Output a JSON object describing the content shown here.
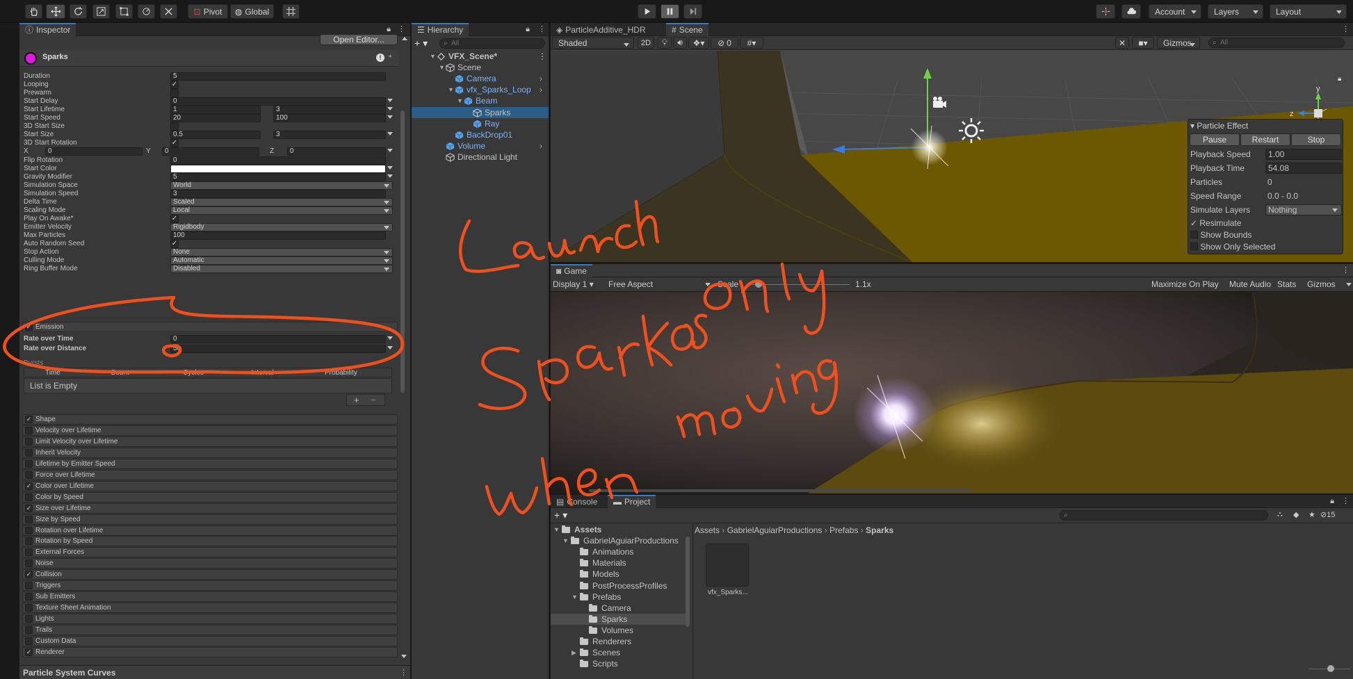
{
  "toolbar": {
    "pivot": "Pivot",
    "global": "Global",
    "account": "Account",
    "layers": "Layers",
    "layout": "Layout"
  },
  "inspector": {
    "tab": "Inspector",
    "open_editor": "Open Editor...",
    "object_name": "Sparks",
    "props": [
      {
        "label": "Duration",
        "value": "5"
      },
      {
        "label": "Looping",
        "check": true
      },
      {
        "label": "Prewarm",
        "check": false
      },
      {
        "label": "Start Delay",
        "value": "0"
      },
      {
        "label": "Start Lifetime",
        "value": "1",
        "value2": "3"
      },
      {
        "label": "Start Speed",
        "value": "20",
        "value2": "100"
      },
      {
        "label": "3D Start Size",
        "check": false
      },
      {
        "label": "Start Size",
        "value": "0.5",
        "value2": "3"
      },
      {
        "label": "3D Start Rotation",
        "check": true
      }
    ],
    "rot_xyz": {
      "x_label": "X",
      "x": "0",
      "y_label": "Y",
      "y": "0",
      "z_label": "Z",
      "z": "0"
    },
    "props2": [
      {
        "label": "Flip Rotation",
        "value": "0"
      },
      {
        "label": "Start Color",
        "color": "#ffffff"
      },
      {
        "label": "Gravity Modifier",
        "value": "5"
      },
      {
        "label": "Simulation Space",
        "popup": "World"
      },
      {
        "label": "Simulation Speed",
        "value": "3"
      },
      {
        "label": "Delta Time",
        "popup": "Scaled"
      },
      {
        "label": "Scaling Mode",
        "popup": "Local"
      },
      {
        "label": "Play On Awake*",
        "check": true
      },
      {
        "label": "Emitter Velocity",
        "popup": "Rigidbody"
      },
      {
        "label": "Max Particles",
        "value": "100"
      },
      {
        "label": "Auto Random Seed",
        "check": true
      },
      {
        "label": "Stop Action",
        "popup": "None"
      },
      {
        "label": "Culling Mode",
        "popup": "Automatic"
      },
      {
        "label": "Ring Buffer Mode",
        "popup": "Disabled"
      }
    ],
    "emission": {
      "title": "Emission",
      "rate_time_label": "Rate over Time",
      "rate_time": "0",
      "rate_dist_label": "Rate over Distance",
      "rate_dist": "50",
      "bursts_label": "Bursts",
      "cols": [
        "Time",
        "Count",
        "Cycles",
        "Interval",
        "Probability"
      ],
      "empty": "List is Empty",
      "add": "+",
      "remove": "−"
    },
    "modules": [
      {
        "label": "Shape",
        "on": true
      },
      {
        "label": "Velocity over Lifetime",
        "on": false
      },
      {
        "label": "Limit Velocity over Lifetime",
        "on": false
      },
      {
        "label": "Inherit Velocity",
        "on": false
      },
      {
        "label": "Lifetime by Emitter Speed",
        "on": false
      },
      {
        "label": "Force over Lifetime",
        "on": false
      },
      {
        "label": "Color over Lifetime",
        "on": true
      },
      {
        "label": "Color by Speed",
        "on": false
      },
      {
        "label": "Size over Lifetime",
        "on": true
      },
      {
        "label": "Size by Speed",
        "on": false
      },
      {
        "label": "Rotation over Lifetime",
        "on": false
      },
      {
        "label": "Rotation by Speed",
        "on": false
      },
      {
        "label": "External Forces",
        "on": false
      },
      {
        "label": "Noise",
        "on": false
      },
      {
        "label": "Collision",
        "on": true
      },
      {
        "label": "Triggers",
        "on": false
      },
      {
        "label": "Sub Emitters",
        "on": false
      },
      {
        "label": "Texture Sheet Animation",
        "on": false
      },
      {
        "label": "Lights",
        "on": false
      },
      {
        "label": "Trails",
        "on": false
      },
      {
        "label": "Custom Data",
        "on": false
      },
      {
        "label": "Renderer",
        "on": true
      }
    ],
    "curves": "Particle System Curves"
  },
  "hierarchy": {
    "tab": "Hierarchy",
    "search": "All",
    "items": [
      {
        "label": "VFX_Scene*",
        "depth": 0,
        "type": "scene",
        "arrow": "▼",
        "bold": true
      },
      {
        "label": "Scene",
        "depth": 1,
        "type": "go",
        "arrow": "▼"
      },
      {
        "label": "Camera",
        "depth": 2,
        "type": "prefab",
        "arrow": "",
        "more": true
      },
      {
        "label": "vfx_Sparks_Loop",
        "depth": 2,
        "type": "prefab",
        "arrow": "▼",
        "more": true
      },
      {
        "label": "Beam",
        "depth": 3,
        "type": "prefab",
        "arrow": "▼"
      },
      {
        "label": "Sparks",
        "depth": 4,
        "type": "go",
        "arrow": "",
        "sel": true
      },
      {
        "label": "Ray",
        "depth": 4,
        "type": "prefab",
        "arrow": ""
      },
      {
        "label": "BackDrop01",
        "depth": 2,
        "type": "prefab",
        "arrow": ""
      },
      {
        "label": "Volume",
        "depth": 1,
        "type": "prefab",
        "arrow": "",
        "more": true
      },
      {
        "label": "Directional Light",
        "depth": 1,
        "type": "go",
        "arrow": ""
      }
    ]
  },
  "scene_tabs": {
    "tab1": "ParticleAdditive_HDR",
    "tab2": "Scene",
    "shading": "Shaded",
    "mode2d": "2D",
    "hidden_count": "0",
    "gizmos": "Gizmos",
    "search": "All"
  },
  "particle_effect": {
    "title": "Particle Effect",
    "pause": "Pause",
    "restart": "Restart",
    "stop": "Stop",
    "speed_label": "Playback Speed",
    "speed": "1.00",
    "time_label": "Playback Time",
    "time": "54.08",
    "particles_label": "Particles",
    "particles": "0",
    "range_label": "Speed Range",
    "range": "0.0 - 0.0",
    "layers_label": "Simulate Layers",
    "layers": "Nothing",
    "resim": "Resimulate",
    "bounds": "Show Bounds",
    "only_sel": "Show Only Selected"
  },
  "game": {
    "tab": "Game",
    "display": "Display 1",
    "aspect": "Free Aspect",
    "scale_label": "Scale",
    "scale": "1.1x",
    "maximize": "Maximize On Play",
    "mute": "Mute Audio",
    "stats": "Stats",
    "gizmos": "Gizmos"
  },
  "project": {
    "tab_console": "Console",
    "tab_project": "Project",
    "hidden_count": "15",
    "breadcrumb": [
      "Assets",
      "GabrielAguiarProductions",
      "Prefabs",
      "Sparks"
    ],
    "tree": [
      {
        "label": "Assets",
        "depth": 0,
        "arrow": "▼",
        "bold": true
      },
      {
        "label": "GabrielAguiarProductions",
        "depth": 1,
        "arrow": "▼"
      },
      {
        "label": "Animations",
        "depth": 2,
        "arrow": ""
      },
      {
        "label": "Materials",
        "depth": 2,
        "arrow": ""
      },
      {
        "label": "Models",
        "depth": 2,
        "arrow": ""
      },
      {
        "label": "PostProcessProfiles",
        "depth": 2,
        "arrow": ""
      },
      {
        "label": "Prefabs",
        "depth": 2,
        "arrow": "▼"
      },
      {
        "label": "Camera",
        "depth": 3,
        "arrow": ""
      },
      {
        "label": "Sparks",
        "depth": 3,
        "arrow": "",
        "sel": true
      },
      {
        "label": "Volumes",
        "depth": 3,
        "arrow": ""
      },
      {
        "label": "Renderers",
        "depth": 2,
        "arrow": ""
      },
      {
        "label": "Scenes",
        "depth": 2,
        "arrow": "▶"
      },
      {
        "label": "Scripts",
        "depth": 2,
        "arrow": ""
      }
    ],
    "asset": "vfx_Sparks..."
  },
  "annotation": {
    "color": "#f0501e"
  }
}
